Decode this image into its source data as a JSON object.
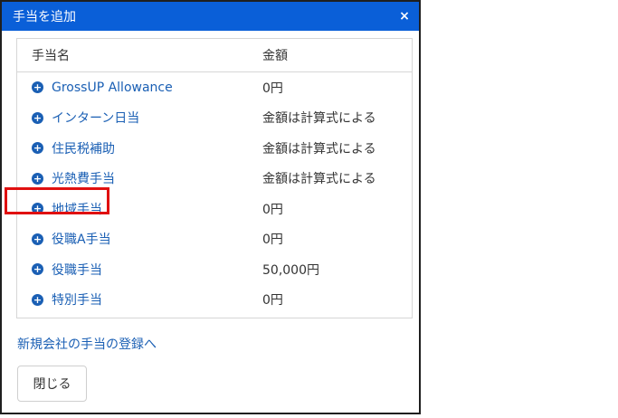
{
  "dialog": {
    "title": "手当を追加",
    "close_glyph": "×"
  },
  "table": {
    "headers": {
      "name": "手当名",
      "amount": "金額"
    },
    "rows": [
      {
        "name": "GrossUP Allowance",
        "amount": "0円"
      },
      {
        "name": "インターン日当",
        "amount": "金額は計算式による"
      },
      {
        "name": "住民税補助",
        "amount": "金額は計算式による"
      },
      {
        "name": "光熱費手当",
        "amount": "金額は計算式による"
      },
      {
        "name": "地域手当",
        "amount": "0円"
      },
      {
        "name": "役職A手当",
        "amount": "0円"
      },
      {
        "name": "役職手当",
        "amount": "50,000円"
      },
      {
        "name": "特別手当",
        "amount": "0円"
      }
    ]
  },
  "footer": {
    "register_link": "新規会社の手当の登録へ",
    "close_button": "閉じる"
  },
  "colors": {
    "titlebar": "#0a5fd8",
    "link": "#1a5fb4",
    "highlight": "#e01010"
  },
  "icons": {
    "add": "plus-circle-icon"
  }
}
